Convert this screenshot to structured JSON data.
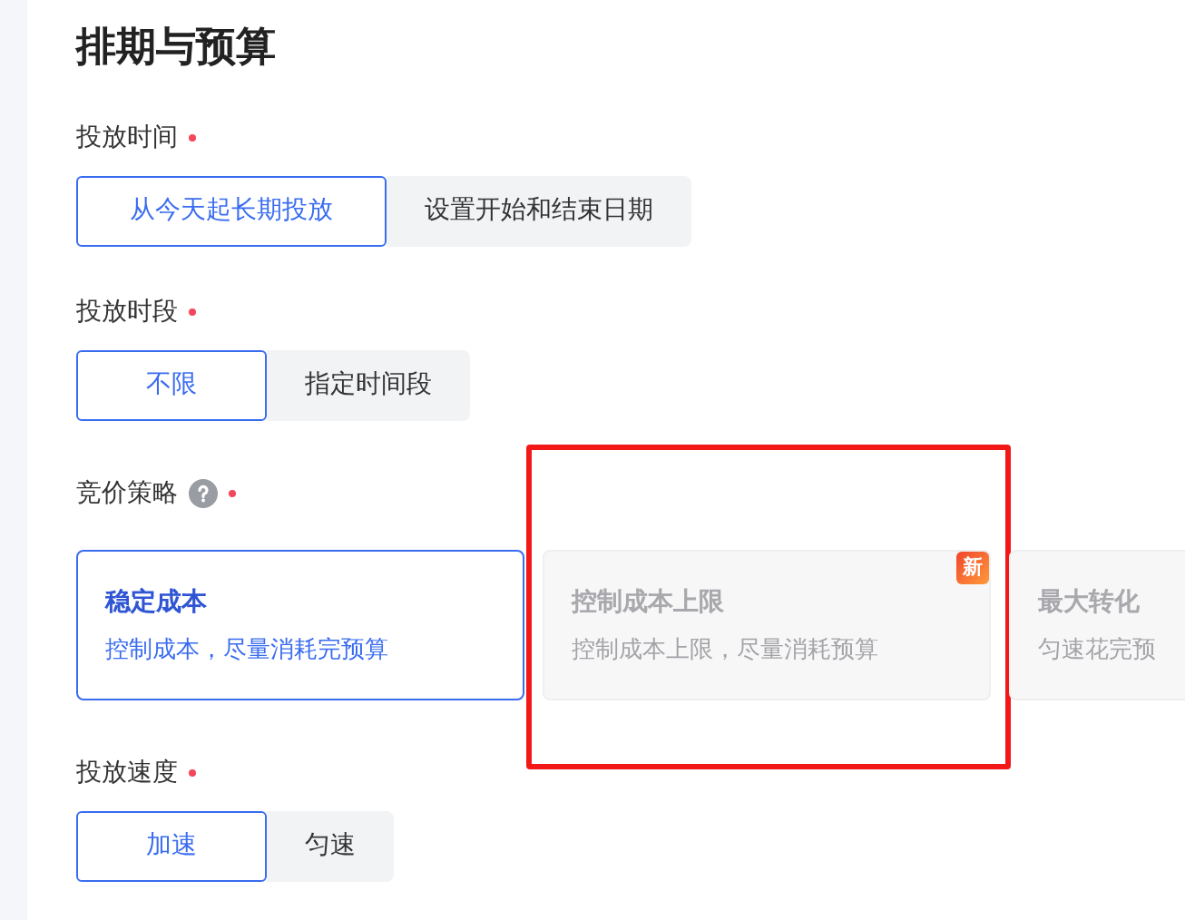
{
  "title": "排期与预算",
  "sections": [
    {
      "kind": "segmented",
      "label": "投放时间",
      "required": true,
      "options": [
        {
          "label": "从今天起长期投放",
          "selected": true
        },
        {
          "label": "设置开始和结束日期",
          "selected": false
        }
      ]
    },
    {
      "kind": "segmented",
      "label": "投放时段",
      "required": true,
      "options": [
        {
          "label": "不限",
          "selected": true
        },
        {
          "label": "指定时间段",
          "selected": false
        }
      ]
    },
    {
      "kind": "cards",
      "label": "竞价策略",
      "help": true,
      "required": true,
      "options": [
        {
          "title": "稳定成本",
          "desc": "控制成本，尽量消耗完预算",
          "selected": true,
          "disabled": false,
          "highlighted": false
        },
        {
          "title": "控制成本上限",
          "desc": "控制成本上限，尽量消耗预算",
          "selected": false,
          "disabled": true,
          "badge": "新",
          "highlighted": true
        },
        {
          "title": "最大转化",
          "desc": "匀速花完预",
          "selected": false,
          "disabled": true,
          "highlighted": false
        }
      ]
    },
    {
      "kind": "segmented",
      "label": "投放速度",
      "required": true,
      "options": [
        {
          "label": "加速",
          "selected": true
        },
        {
          "label": "匀速",
          "selected": false
        }
      ]
    }
  ]
}
